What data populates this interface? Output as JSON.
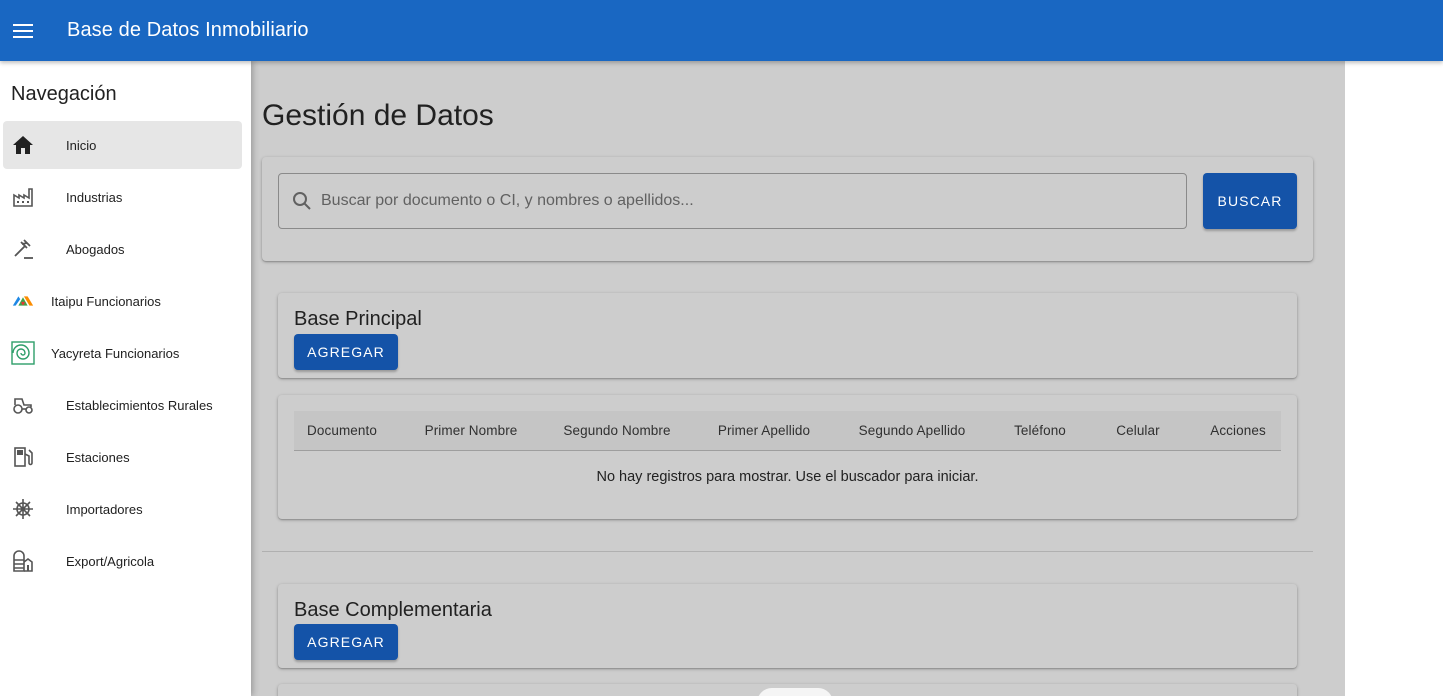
{
  "app": {
    "title": "Base de Datos Inmobiliario"
  },
  "drawer": {
    "title": "Navegación",
    "items": [
      {
        "label": "Inicio",
        "icon": "home-icon",
        "active": true
      },
      {
        "label": "Industrias",
        "icon": "factory-icon"
      },
      {
        "label": "Abogados",
        "icon": "gavel-icon"
      },
      {
        "label": "Itaipu Funcionarios",
        "icon": "itaipu-logo-icon"
      },
      {
        "label": "Yacyreta Funcionarios",
        "icon": "yacyreta-logo-icon"
      },
      {
        "label": "Establecimientos Rurales",
        "icon": "tractor-icon"
      },
      {
        "label": "Estaciones",
        "icon": "gas-station-icon"
      },
      {
        "label": "Importadores",
        "icon": "ship-wheel-icon"
      },
      {
        "label": "Export/Agricola",
        "icon": "silo-icon"
      }
    ]
  },
  "main": {
    "title": "Gestión de Datos",
    "search": {
      "placeholder": "Buscar por documento o CI, y nombres o apellidos...",
      "value": "",
      "button_label": "BUSCAR"
    },
    "base_principal": {
      "title": "Base Principal",
      "add_label": "AGREGAR",
      "columns": [
        "Documento",
        "Primer Nombre",
        "Segundo Nombre",
        "Primer Apellido",
        "Segundo Apellido",
        "Teléfono",
        "Celular",
        "Acciones"
      ],
      "empty_message": "No hay registros para mostrar. Use el buscador para iniciar."
    },
    "base_complementaria": {
      "title": "Base Complementaria",
      "add_label": "AGREGAR"
    }
  },
  "colors": {
    "appbar": "#1967c2",
    "button": "#1453a8",
    "content_bg": "#cdcdcd"
  }
}
